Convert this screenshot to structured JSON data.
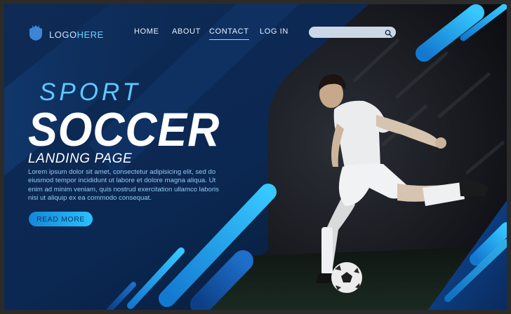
{
  "brand": {
    "logo_part1": "LOGO",
    "logo_part2": "HERE"
  },
  "nav": {
    "items": [
      {
        "label": "HOME"
      },
      {
        "label": "ABOUT"
      },
      {
        "label": "CONTACT",
        "active": true
      },
      {
        "label": "LOG IN"
      }
    ]
  },
  "search": {
    "value": "",
    "placeholder": ""
  },
  "hero": {
    "kicker": "SPORT",
    "title": "SOCCER",
    "subtitle": "LANDING PAGE",
    "body": "Lorem ipsum dolor sit amet, consectetur adipisicing elit, sed do eiusmod tempor incididunt ut labore et dolore magna aliqua. Ut enim ad minim veniam, quis nostrud exercitation ullamco laboris nisi ut aliquip ex ea commodo consequat.",
    "cta_label": "READ MORE"
  },
  "colors": {
    "navy": "#0b1a33",
    "accent_blue": "#2fb7f5",
    "light_blue": "#5fc8ff",
    "dark_photo": "#0d0f12"
  },
  "icons": [
    "shield-logo-icon",
    "search-icon"
  ]
}
